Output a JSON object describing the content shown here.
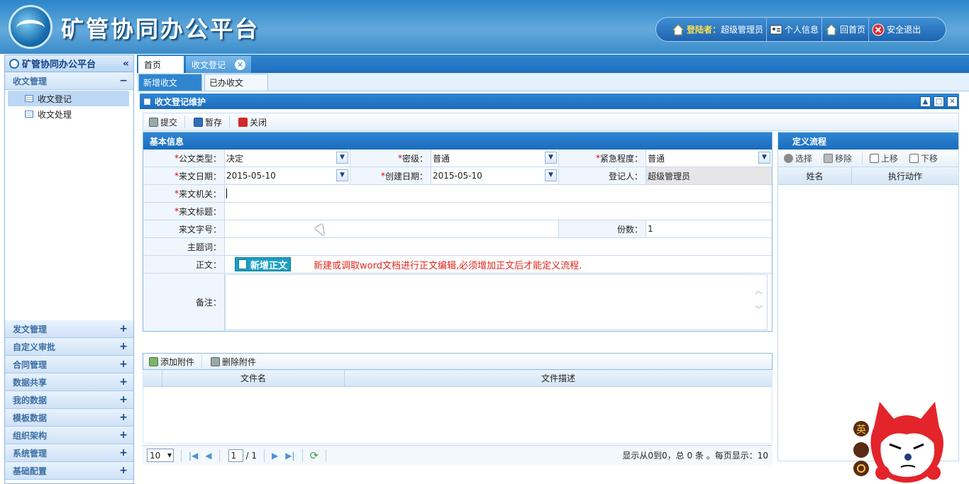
{
  "header": {
    "app_title": "矿管协同办公平台",
    "login_label": "登陆者：",
    "login_user": "超级管理员",
    "profile_label": "个人信息",
    "home_label": "回首页",
    "logout_label": "安全退出"
  },
  "sidebar": {
    "title": "矿管协同办公平台",
    "collapse_glyph": "«",
    "open_group": {
      "label": "收文管理",
      "sign": "−"
    },
    "items": [
      {
        "label": "收文登记",
        "selected": true
      },
      {
        "label": "收文处理",
        "selected": false
      }
    ],
    "groups": [
      {
        "label": "发文管理",
        "sign": "+"
      },
      {
        "label": "自定义审批",
        "sign": "+"
      },
      {
        "label": "合同管理",
        "sign": "+"
      },
      {
        "label": "数据共享",
        "sign": "+"
      },
      {
        "label": "我的数据",
        "sign": "+"
      },
      {
        "label": "模板数据",
        "sign": "+"
      },
      {
        "label": "组织架构",
        "sign": "+"
      },
      {
        "label": "系统管理",
        "sign": "+"
      },
      {
        "label": "基础配置",
        "sign": "+"
      }
    ]
  },
  "tabs": {
    "home": "首页",
    "active": "收文登记",
    "close_glyph": "✕",
    "sub": [
      "新增收文",
      "已办收文"
    ]
  },
  "panel": {
    "title": "收文登记维护",
    "toolbar": {
      "submit": "提交",
      "save": "暂存",
      "close": "关闭"
    }
  },
  "form": {
    "section_title": "基本信息",
    "required_mark": "*",
    "doc_type_label": "公文类型：",
    "doc_type_value": "决定",
    "secret_label": "密级：",
    "secret_value": "普通",
    "urgency_label": "紧急程度：",
    "urgency_value": "普通",
    "recv_date_label": "来文日期：",
    "recv_date_value": "2015-05-10",
    "create_date_label": "创建日期：",
    "create_date_value": "2015-05-10",
    "registrar_label": "登记人：",
    "registrar_value": "超级管理员",
    "org_label": "来文机关：",
    "subject_title_label": "来文标题：",
    "doc_no_label": "来文字号：",
    "copies_label": "份数：",
    "copies_value": "1",
    "keywords_label": "主题词：",
    "body_label": "正文：",
    "new_body_button": "新增正文",
    "body_notice": "新建或调取word文档进行正文编辑,必须增加正文后才能定义流程.",
    "remark_label": "备注："
  },
  "attachments": {
    "add_label": "添加附件",
    "delete_label": "删除附件",
    "columns": [
      "文件名",
      "文件描述"
    ]
  },
  "pager": {
    "page_size": "10",
    "page_current": "1",
    "page_total": "/ 1",
    "info": "显示从0到0，总 0 条 。每页显示：10"
  },
  "flow": {
    "title": "定义流程",
    "toolbar": {
      "select": "选择",
      "remove": "移除",
      "up": "上移",
      "down": "下移"
    },
    "columns": [
      "姓名",
      "执行动作"
    ]
  },
  "mascot": {
    "ime_label": "英"
  },
  "colors": {
    "header_blue": "#2b86c9",
    "panel_blue": "#1b6cbd",
    "notice_red": "#e0251b",
    "required_red": "#dd0000"
  }
}
